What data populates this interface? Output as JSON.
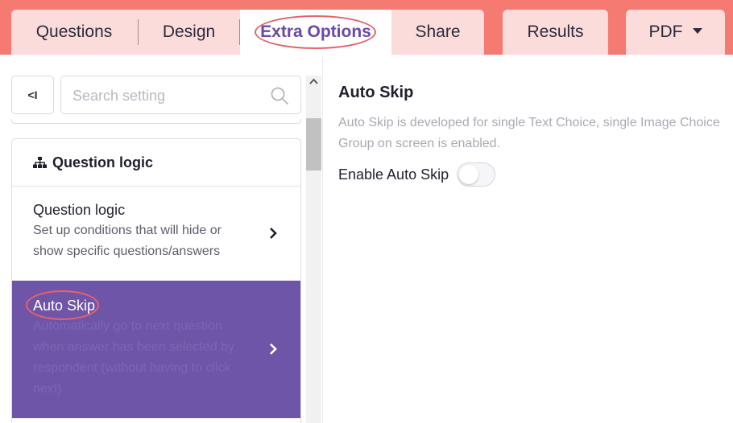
{
  "tabs": {
    "questions": "Questions",
    "design": "Design",
    "extra_options": "Extra Options",
    "share": "Share",
    "results": "Results",
    "pdf": "PDF"
  },
  "sidebar": {
    "collapse_glyph": "<I",
    "search_placeholder": "Search setting",
    "section_title": "Question logic",
    "items": [
      {
        "title": "Question logic",
        "description_lines": [
          "Set up conditions that will hide or",
          "show specific questions/answers"
        ]
      },
      {
        "title": "Auto Skip",
        "description_lines": [
          "Automatically go to next question",
          "when answer has been selected by",
          "respondent (without having to click",
          "next)"
        ]
      }
    ]
  },
  "content": {
    "title": "Auto Skip",
    "description_lines": [
      "Auto Skip is developed for single Text Choice, single Image Choice",
      "Group on screen is enabled."
    ],
    "toggle_label": "Enable Auto Skip",
    "toggle_on": false
  },
  "colors": {
    "tab_bar": "#f47a72",
    "tab_bg": "#fbdcda",
    "active_tab_text": "#6b47a8",
    "selected_item_bg": "#6f55a8",
    "highlight_ring": "#e8606a"
  }
}
